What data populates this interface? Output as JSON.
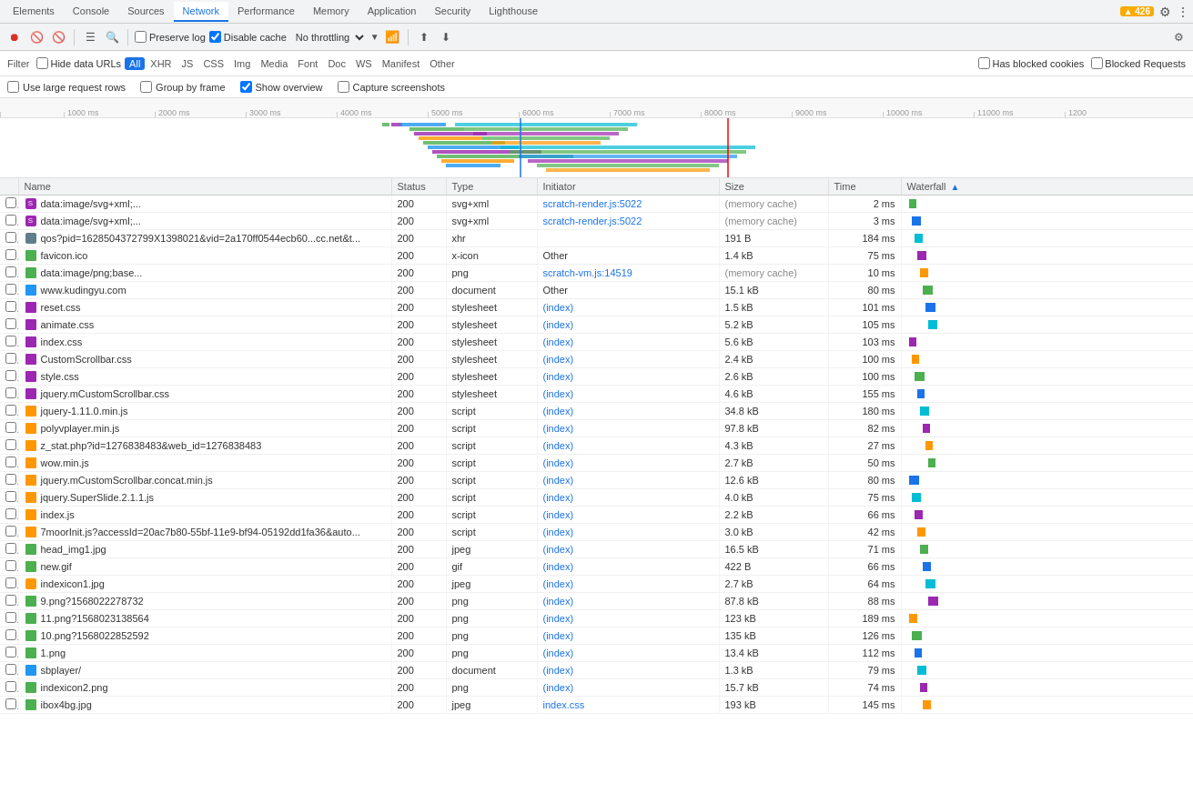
{
  "tabs": [
    {
      "id": "elements",
      "label": "Elements",
      "active": false
    },
    {
      "id": "console",
      "label": "Console",
      "active": false
    },
    {
      "id": "sources",
      "label": "Sources",
      "active": false
    },
    {
      "id": "network",
      "label": "Network",
      "active": true
    },
    {
      "id": "performance",
      "label": "Performance",
      "active": false
    },
    {
      "id": "memory",
      "label": "Memory",
      "active": false
    },
    {
      "id": "application",
      "label": "Application",
      "active": false
    },
    {
      "id": "security",
      "label": "Security",
      "active": false
    },
    {
      "id": "lighthouse",
      "label": "Lighthouse",
      "active": false
    }
  ],
  "toolbar": {
    "preserve_log_label": "Preserve log",
    "disable_cache_label": "Disable cache",
    "throttle_label": "No throttling"
  },
  "filter": {
    "label": "Filter",
    "hide_data_urls_label": "Hide data URLs",
    "types": [
      "All",
      "XHR",
      "JS",
      "CSS",
      "Img",
      "Media",
      "Font",
      "Doc",
      "WS",
      "Manifest",
      "Other"
    ],
    "active_type": "All",
    "has_blocked_cookies_label": "Has blocked cookies",
    "blocked_requests_label": "Blocked Requests"
  },
  "options": {
    "large_rows_label": "Use large request rows",
    "large_rows_checked": false,
    "group_by_frame_label": "Group by frame",
    "group_by_frame_checked": false,
    "show_overview_label": "Show overview",
    "show_overview_checked": true,
    "capture_screenshots_label": "Capture screenshots",
    "capture_screenshots_checked": false
  },
  "timeline": {
    "ticks": [
      "1000 ms",
      "2000 ms",
      "3000 ms",
      "4000 ms",
      "5000 ms",
      "6000 ms",
      "7000 ms",
      "8000 ms",
      "9000 ms",
      "10000 ms",
      "11000 ms",
      "1200"
    ]
  },
  "table": {
    "columns": [
      "Name",
      "Status",
      "Type",
      "Initiator",
      "Size",
      "Time",
      "Waterfall"
    ],
    "rows": [
      {
        "name": "data:image/svg+xml;...",
        "status": "200",
        "type": "svg+xml",
        "initiator": "scratch-render.js:5022",
        "initiator_link": true,
        "size": "(memory cache)",
        "time": "2 ms",
        "icon": "svg",
        "checkbox": false
      },
      {
        "name": "data:image/svg+xml;...",
        "status": "200",
        "type": "svg+xml",
        "initiator": "scratch-render.js:5022",
        "initiator_link": true,
        "size": "(memory cache)",
        "time": "3 ms",
        "icon": "svg",
        "checkbox": false
      },
      {
        "name": "qos?pid=1628504372799X1398021&vid=2a170ff0544ecb60...cc.net&t...",
        "status": "200",
        "type": "xhr",
        "initiator": "",
        "initiator_link": false,
        "size": "191 B",
        "time": "184 ms",
        "icon": "xhr",
        "checkbox": false
      },
      {
        "name": "favicon.ico",
        "status": "200",
        "type": "x-icon",
        "initiator": "Other",
        "initiator_link": false,
        "size": "1.4 kB",
        "time": "75 ms",
        "icon": "img",
        "checkbox": false
      },
      {
        "name": "data:image/png;base...",
        "status": "200",
        "type": "png",
        "initiator": "scratch-vm.js:14519",
        "initiator_link": true,
        "size": "(memory cache)",
        "time": "10 ms",
        "icon": "img",
        "checkbox": false
      },
      {
        "name": "www.kudingyu.com",
        "status": "200",
        "type": "document",
        "initiator": "Other",
        "initiator_link": false,
        "size": "15.1 kB",
        "time": "80 ms",
        "icon": "doc",
        "checkbox": false
      },
      {
        "name": "reset.css",
        "status": "200",
        "type": "stylesheet",
        "initiator": "(index)",
        "initiator_link": true,
        "size": "1.5 kB",
        "time": "101 ms",
        "icon": "style",
        "checkbox": false
      },
      {
        "name": "animate.css",
        "status": "200",
        "type": "stylesheet",
        "initiator": "(index)",
        "initiator_link": true,
        "size": "5.2 kB",
        "time": "105 ms",
        "icon": "style",
        "checkbox": false
      },
      {
        "name": "index.css",
        "status": "200",
        "type": "stylesheet",
        "initiator": "(index)",
        "initiator_link": true,
        "size": "5.6 kB",
        "time": "103 ms",
        "icon": "style",
        "checkbox": false
      },
      {
        "name": "CustomScrollbar.css",
        "status": "200",
        "type": "stylesheet",
        "initiator": "(index)",
        "initiator_link": true,
        "size": "2.4 kB",
        "time": "100 ms",
        "icon": "style",
        "checkbox": false
      },
      {
        "name": "style.css",
        "status": "200",
        "type": "stylesheet",
        "initiator": "(index)",
        "initiator_link": true,
        "size": "2.6 kB",
        "time": "100 ms",
        "icon": "style",
        "checkbox": false
      },
      {
        "name": "jquery.mCustomScrollbar.css",
        "status": "200",
        "type": "stylesheet",
        "initiator": "(index)",
        "initiator_link": true,
        "size": "4.6 kB",
        "time": "155 ms",
        "icon": "style",
        "checkbox": false
      },
      {
        "name": "jquery-1.11.0.min.js",
        "status": "200",
        "type": "script",
        "initiator": "(index)",
        "initiator_link": true,
        "size": "34.8 kB",
        "time": "180 ms",
        "icon": "script",
        "checkbox": false
      },
      {
        "name": "polyvplayer.min.js",
        "status": "200",
        "type": "script",
        "initiator": "(index)",
        "initiator_link": true,
        "size": "97.8 kB",
        "time": "82 ms",
        "icon": "script",
        "checkbox": false
      },
      {
        "name": "z_stat.php?id=1276838483&web_id=1276838483",
        "status": "200",
        "type": "script",
        "initiator": "(index)",
        "initiator_link": true,
        "size": "4.3 kB",
        "time": "27 ms",
        "icon": "script",
        "checkbox": false
      },
      {
        "name": "wow.min.js",
        "status": "200",
        "type": "script",
        "initiator": "(index)",
        "initiator_link": true,
        "size": "2.7 kB",
        "time": "50 ms",
        "icon": "script",
        "checkbox": false
      },
      {
        "name": "jquery.mCustomScrollbar.concat.min.js",
        "status": "200",
        "type": "script",
        "initiator": "(index)",
        "initiator_link": true,
        "size": "12.6 kB",
        "time": "80 ms",
        "icon": "script",
        "checkbox": false
      },
      {
        "name": "jquery.SuperSlide.2.1.1.js",
        "status": "200",
        "type": "script",
        "initiator": "(index)",
        "initiator_link": true,
        "size": "4.0 kB",
        "time": "75 ms",
        "icon": "script",
        "checkbox": false
      },
      {
        "name": "index.js",
        "status": "200",
        "type": "script",
        "initiator": "(index)",
        "initiator_link": true,
        "size": "2.2 kB",
        "time": "66 ms",
        "icon": "script",
        "checkbox": false
      },
      {
        "name": "7moorInit.js?accessId=20ac7b80-55bf-11e9-bf94-05192dd1fa36&auto...",
        "status": "200",
        "type": "script",
        "initiator": "(index)",
        "initiator_link": true,
        "size": "3.0 kB",
        "time": "42 ms",
        "icon": "script",
        "checkbox": false
      },
      {
        "name": "head_img1.jpg",
        "status": "200",
        "type": "jpeg",
        "initiator": "(index)",
        "initiator_link": true,
        "size": "16.5 kB",
        "time": "71 ms",
        "icon": "img",
        "checkbox": false
      },
      {
        "name": "new.gif",
        "status": "200",
        "type": "gif",
        "initiator": "(index)",
        "initiator_link": true,
        "size": "422 B",
        "time": "66 ms",
        "icon": "img",
        "checkbox": false
      },
      {
        "name": "indexicon1.jpg",
        "status": "200",
        "type": "jpeg",
        "initiator": "(index)",
        "initiator_link": true,
        "size": "2.7 kB",
        "time": "64 ms",
        "icon": "img-orange",
        "checkbox": false
      },
      {
        "name": "9.png?1568022278732",
        "status": "200",
        "type": "png",
        "initiator": "(index)",
        "initiator_link": true,
        "size": "87.8 kB",
        "time": "88 ms",
        "icon": "img",
        "checkbox": false
      },
      {
        "name": "11.png?1568023138564",
        "status": "200",
        "type": "png",
        "initiator": "(index)",
        "initiator_link": true,
        "size": "123 kB",
        "time": "189 ms",
        "icon": "img",
        "checkbox": false
      },
      {
        "name": "10.png?1568022852592",
        "status": "200",
        "type": "png",
        "initiator": "(index)",
        "initiator_link": true,
        "size": "135 kB",
        "time": "126 ms",
        "icon": "img",
        "checkbox": false
      },
      {
        "name": "1.png",
        "status": "200",
        "type": "png",
        "initiator": "(index)",
        "initiator_link": true,
        "size": "13.4 kB",
        "time": "112 ms",
        "icon": "img",
        "checkbox": false
      },
      {
        "name": "sbplayer/",
        "status": "200",
        "type": "document",
        "initiator": "(index)",
        "initiator_link": true,
        "size": "1.3 kB",
        "time": "79 ms",
        "icon": "doc",
        "checkbox": false
      },
      {
        "name": "indexicon2.png",
        "status": "200",
        "type": "png",
        "initiator": "(index)",
        "initiator_link": true,
        "size": "15.7 kB",
        "time": "74 ms",
        "icon": "img",
        "checkbox": false
      },
      {
        "name": "ibox4bg.jpg",
        "status": "200",
        "type": "jpeg",
        "initiator": "index.css",
        "initiator_link": true,
        "size": "193 kB",
        "time": "145 ms",
        "icon": "img",
        "checkbox": false
      }
    ]
  },
  "alert": {
    "count": "426"
  },
  "waterfall_offset": 0
}
